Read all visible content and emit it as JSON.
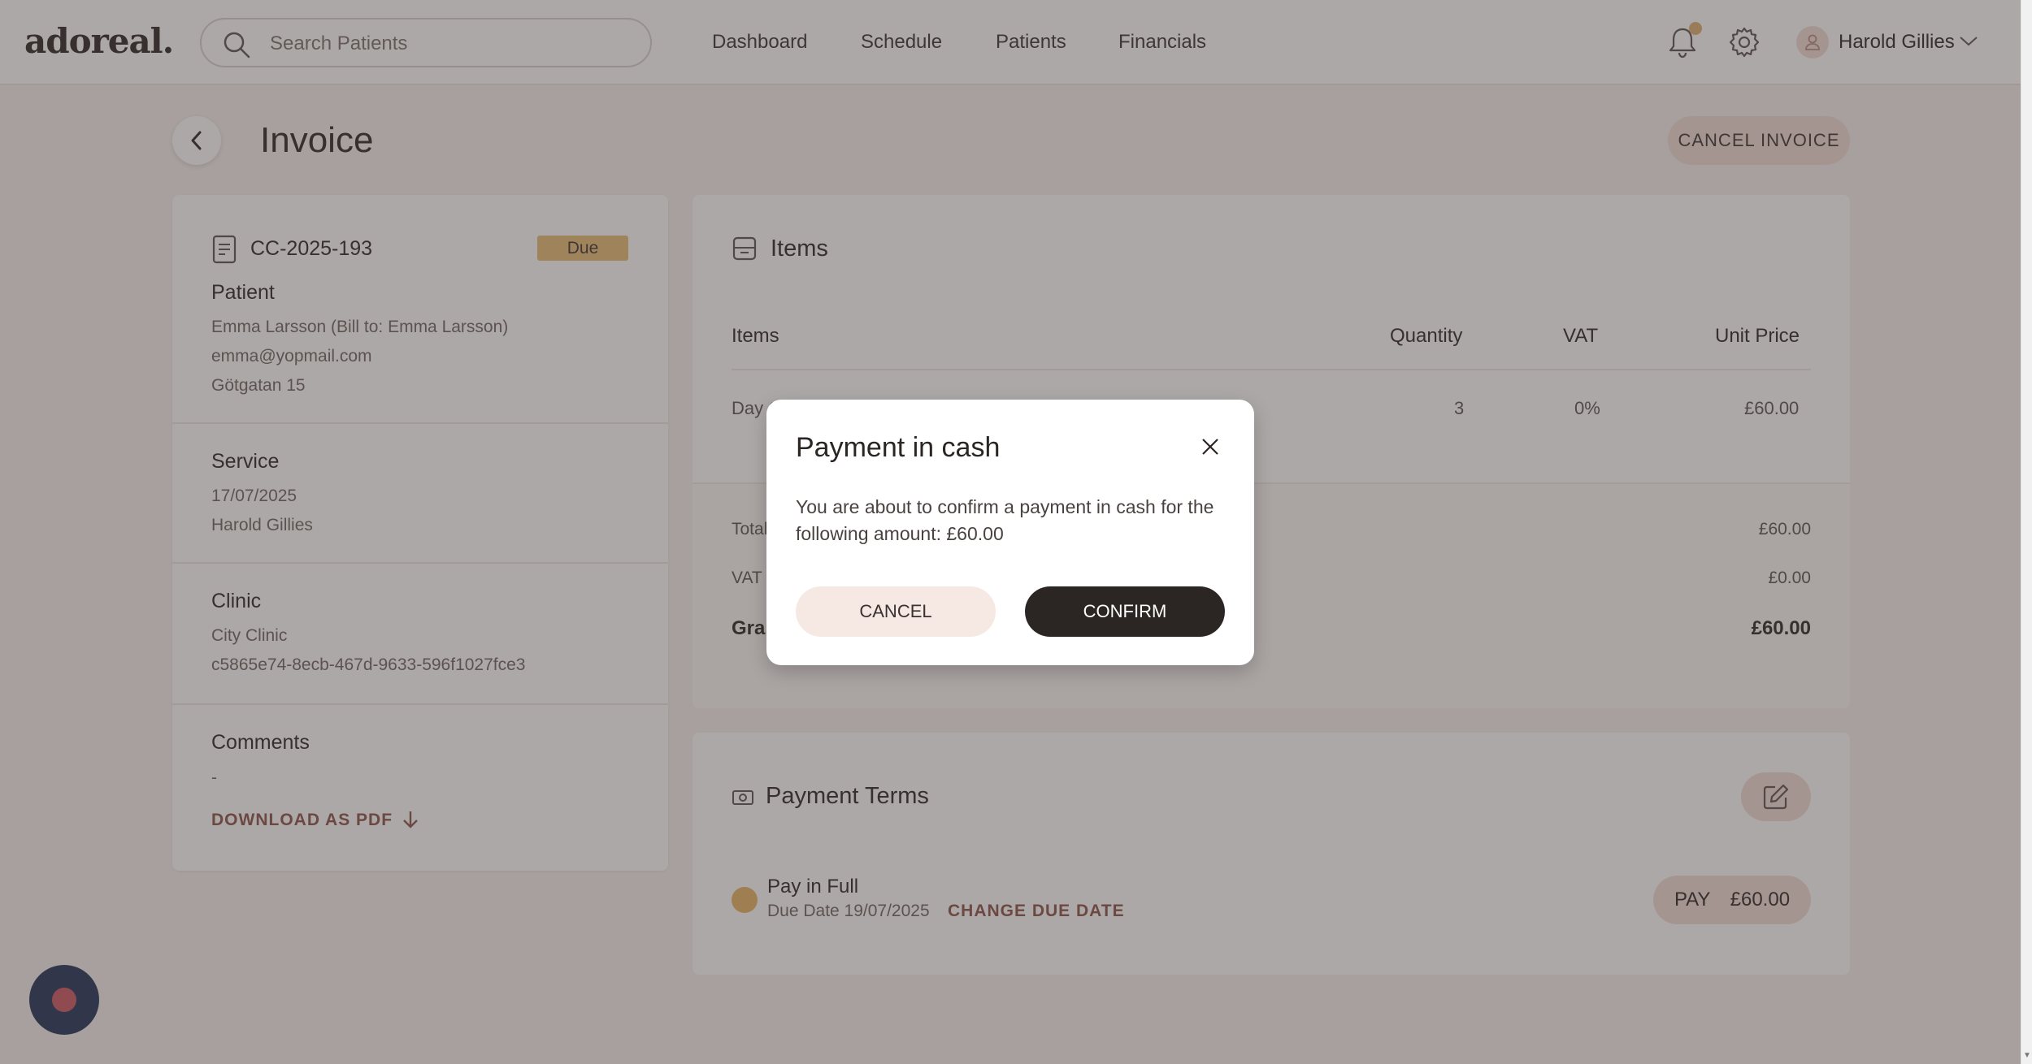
{
  "header": {
    "logo": "adoreal.",
    "search_placeholder": "Search Patients",
    "nav": [
      "Dashboard",
      "Schedule",
      "Patients",
      "Financials"
    ],
    "user_name": "Harold Gillies"
  },
  "page": {
    "title": "Invoice",
    "cancel_invoice_label": "CANCEL INVOICE"
  },
  "invoice": {
    "number": "CC-2025-193",
    "status": "Due",
    "patient": {
      "heading": "Patient",
      "name_line": "Emma Larsson (Bill to: Emma Larsson)",
      "email": "emma@yopmail.com",
      "address": "Götgatan 15"
    },
    "service": {
      "heading": "Service",
      "date": "17/07/2025",
      "practitioner": "Harold Gillies"
    },
    "clinic": {
      "heading": "Clinic",
      "name": "City Clinic",
      "id": "c5865e74-8ecb-467d-9633-596f1027fce3"
    },
    "comments": {
      "heading": "Comments",
      "value": "-"
    },
    "download_label": "DOWNLOAD AS PDF"
  },
  "items": {
    "title": "Items",
    "columns": [
      "Items",
      "Quantity",
      "VAT",
      "Unit Price"
    ],
    "rows": [
      {
        "name": "Day C",
        "quantity": "3",
        "vat": "0%",
        "unit_price": "£60.00"
      }
    ],
    "totals": [
      {
        "label": "Total",
        "value": "£60.00"
      },
      {
        "label": "VAT",
        "value": "£0.00"
      },
      {
        "label": "Gran",
        "value": "£60.00"
      }
    ]
  },
  "payment_terms": {
    "title": "Payment Terms",
    "term_name": "Pay in Full",
    "due_date": "Due Date 19/07/2025",
    "change_due_label": "CHANGE DUE DATE",
    "pay_label": "PAY",
    "pay_amount": "£60.00"
  },
  "modal": {
    "title": "Payment in cash",
    "body": "You are about to confirm a payment in cash for the following amount: £60.00",
    "cancel_label": "CANCEL",
    "confirm_label": "CONFIRM"
  },
  "colors": {
    "accent_dark": "#2b2523",
    "link": "#8a5148",
    "badge_due": "#e8bd76",
    "button_soft": "#f2dcd6",
    "fab": "#1f3156",
    "fab_dot": "#cc5762"
  }
}
